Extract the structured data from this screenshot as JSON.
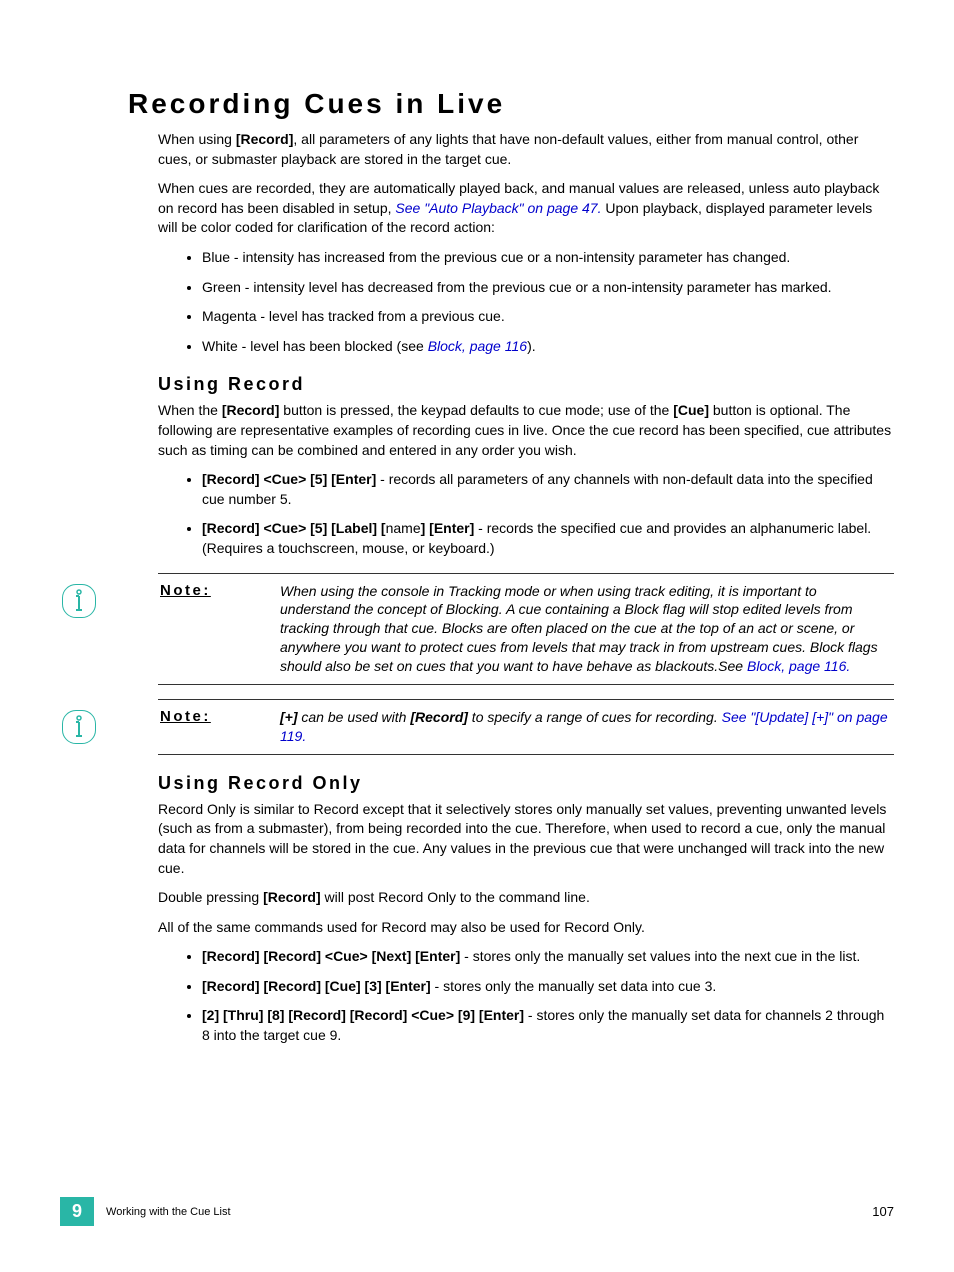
{
  "title": "Recording Cues in Live",
  "intro1_a": "When using ",
  "intro1_b": "[Record]",
  "intro1_c": ", all parameters of any lights that have non-default values, either from manual control, other cues, or submaster playback are stored in the target cue.",
  "intro2_a": "When cues are recorded, they are automatically played back, and manual values are released, unless auto playback on record has been disabled in setup, ",
  "intro2_link": "See \"Auto Playback\" on page 47.",
  "intro2_b": " Upon playback, displayed parameter levels will be color coded for clarification of the record action:",
  "colors": {
    "blue": "Blue - intensity has increased from the previous cue or a non-intensity parameter has changed.",
    "green": "Green - intensity level has decreased from the previous cue or a non-intensity parameter has marked.",
    "magenta": "Magenta - level has tracked from a previous cue.",
    "white_a": "White - level has been blocked (see ",
    "white_link": "Block, page 116",
    "white_b": ")."
  },
  "using_record": {
    "heading": "Using Record",
    "p1_a": "When the ",
    "p1_b": "[Record]",
    "p1_c": " button is pressed, the keypad defaults to cue mode; use of the ",
    "p1_d": "[Cue]",
    "p1_e": " button is optional. The following are representative examples of recording cues in live. Once the cue record has been specified, cue attributes such as timing can be combined and entered in any order you wish.",
    "li1_b": "[Record] <Cue> [5] [Enter]",
    "li1_t": " - records all parameters of any channels with non-default data into the specified cue number 5.",
    "li2_b1": "[Record] <Cue> [5] [Label] [",
    "li2_t1": "name",
    "li2_b2": "] [Enter]",
    "li2_t2": " - records the specified cue and provides an alphanumeric label. (Requires a touchscreen, mouse, or keyboard.)"
  },
  "note1": {
    "label": "Note:",
    "body_a": "When using the console in Tracking mode or when using track editing, it is important to understand the concept of Blocking. A cue containing a Block flag will stop edited levels from tracking through that cue. Blocks are often placed on the cue at the top of an act or scene, or anywhere you want to protect cues from levels that may track in from upstream cues. Block flags should also be set on cues that you want to have behave as blackouts.See ",
    "body_link": "Block, page 116."
  },
  "note2": {
    "label": "Note:",
    "b1": "[+]",
    "t1": " can be used with ",
    "b2": "[Record]",
    "t2": " to specify a range of cues for recording. ",
    "link": "See \"[Update] [+]\" on page 119."
  },
  "using_record_only": {
    "heading": "Using Record Only",
    "p1": "Record Only is similar to Record except that it selectively stores only manually set values, preventing unwanted levels (such as from a submaster), from being recorded into the cue. Therefore, when used to record a cue, only the manual data for channels will be stored in the cue. Any values in the previous cue that were unchanged will track into the new cue.",
    "p2_a": "Double pressing ",
    "p2_b": "[Record]",
    "p2_c": " will post Record Only to the command line.",
    "p3": "All of the same commands used for Record may also be used for Record Only.",
    "li1_b": "[Record] [Record] <Cue> [Next] [Enter]",
    "li1_t": " - stores only the manually set values into the next cue in the list.",
    "li2_b": "[Record] [Record] [Cue] [3] [Enter]",
    "li2_t": " - stores only the manually set data into cue 3.",
    "li3_b": "[2] [Thru] [8] [Record] [Record] <Cue> [9] [Enter]",
    "li3_t": " - stores only the manually set data for channels 2 through 8 into the target cue 9."
  },
  "footer": {
    "chapter": "9",
    "section": "Working with the Cue List",
    "page": "107"
  }
}
